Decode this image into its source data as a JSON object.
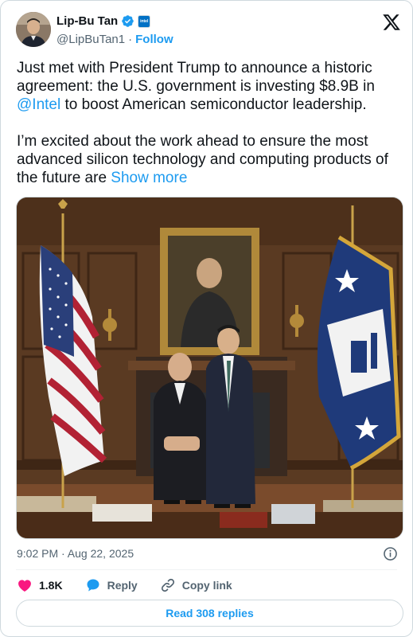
{
  "author": {
    "name": "Lip-Bu Tan",
    "handle": "@LipBuTan1",
    "separator": "·",
    "follow_label": "Follow",
    "verified_icon": "verified-badge-icon",
    "affiliate_icon": "intel-affiliate-badge",
    "affiliate_text": "intel"
  },
  "tweet": {
    "paragraph1_before": "Just met with President Trump to announce a historic agreement: the U.S. government is investing $8.9B in ",
    "mention": "@Intel",
    "paragraph1_after": " to boost American semiconductor leadership.",
    "paragraph2": "I’m excited about the work ahead to ensure the most advanced silicon technology and computing products of the future are ",
    "show_more": "Show more"
  },
  "photo": {
    "icon": "photo-image",
    "colors": {
      "wood": "#5a3a22",
      "floor": "#7a4b2c",
      "flag_blue": "#1f3a7a",
      "flag_red": "#b22234"
    }
  },
  "meta": {
    "timestamp": "9:02 PM · Aug 22, 2025",
    "info_icon": "info-icon"
  },
  "actions": {
    "likes": "1.8K",
    "reply_label": "Reply",
    "copy_label": "Copy link",
    "like_color": "#f91880",
    "reply_color": "#1d9bf0"
  },
  "footer": {
    "read_replies": "Read 308 replies"
  },
  "colors": {
    "accent": "#1d9bf0",
    "text": "#0f1419",
    "muted": "#536471",
    "border": "#cfd9de"
  }
}
